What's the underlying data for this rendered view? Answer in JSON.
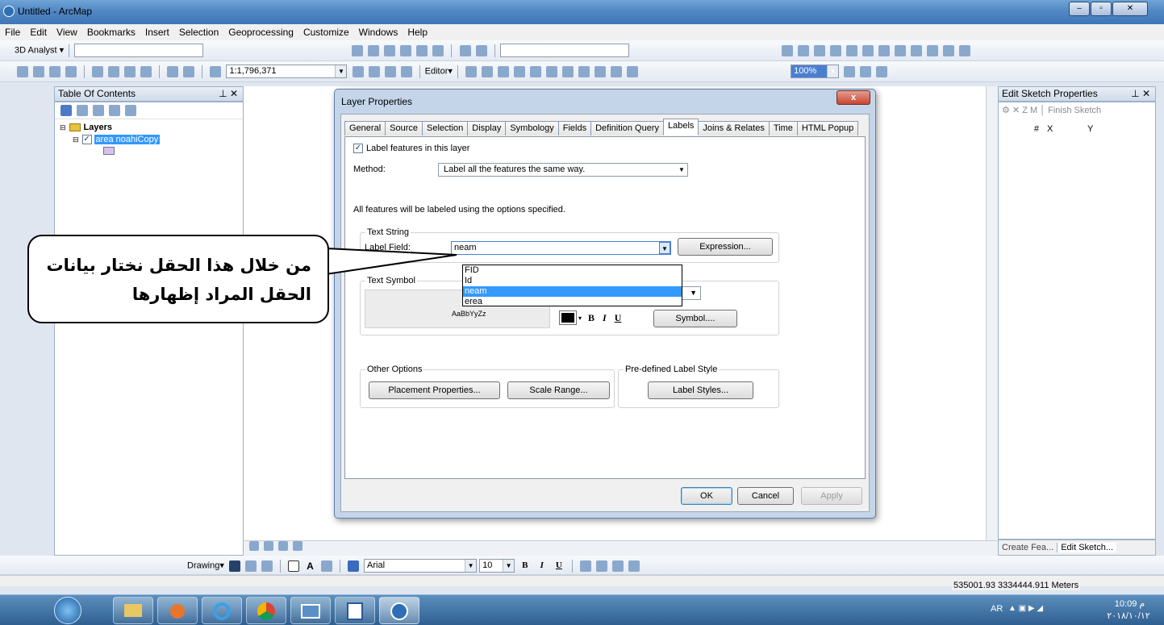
{
  "window": {
    "title": "Untitled - ArcMap"
  },
  "menu": [
    "File",
    "Edit",
    "View",
    "Bookmarks",
    "Insert",
    "Selection",
    "Geoprocessing",
    "Customize",
    "Windows",
    "Help"
  ],
  "toolbar": {
    "analyst": "3D Analyst ▾",
    "scale": "1:1,796,371",
    "editor": "Editor▾",
    "zoom": "100%"
  },
  "toc": {
    "title": "Table Of Contents",
    "root": "Layers",
    "layer": "area noahiCopy"
  },
  "right_pane": {
    "title": "Edit Sketch Properties",
    "toolbar_text": "Finish Sketch",
    "columns": [
      "#",
      "X",
      "Y"
    ],
    "tabs": [
      "Create Fea...",
      "Edit Sketch..."
    ]
  },
  "dialog": {
    "title": "Layer Properties",
    "close": "x",
    "tabs": [
      "General",
      "Source",
      "Selection",
      "Display",
      "Symbology",
      "Fields",
      "Definition Query",
      "Labels",
      "Joins & Relates",
      "Time",
      "HTML Popup"
    ],
    "active_tab": "Labels",
    "label_features": "Label features in this layer",
    "method_label": "Method:",
    "method_value": "Label all the features the same way.",
    "info": "All features will be labeled using the options specified.",
    "text_string_group": "Text String",
    "label_field_label": "Label Field:",
    "label_field_value": "neam",
    "field_options": [
      "FID",
      "Id",
      "neam",
      "erea"
    ],
    "selected_option": "neam",
    "expression_btn": "Expression...",
    "text_symbol_group": "Text Symbol",
    "symbol_preview": "AaBbYyZz",
    "bold": "B",
    "italic": "I",
    "underline": "U",
    "symbol_btn": "Symbol....",
    "other_options_group": "Other Options",
    "placement_btn": "Placement Properties...",
    "scale_btn": "Scale Range...",
    "predefined_group": "Pre-defined Label Style",
    "label_styles_btn": "Label Styles...",
    "ok": "OK",
    "cancel": "Cancel",
    "apply": "Apply"
  },
  "callout": {
    "line1": "من خلال هذا الحقل نختار بيانات",
    "line2": "الحقل المراد إظهارها"
  },
  "drawing": {
    "label": "Drawing▾",
    "font": "Arial",
    "size": "10",
    "bold": "B",
    "italic": "I",
    "underline": "U"
  },
  "status": {
    "coords": "535001.93  3334444.911 Meters"
  },
  "tray": {
    "lang": "AR",
    "time": "10:09 م",
    "date": "٢٠١٨/١٠/١٢"
  },
  "colors": {
    "selection": "#3399ff",
    "titlebar": "#4f86c2",
    "taskbar": "#2f5f91"
  }
}
